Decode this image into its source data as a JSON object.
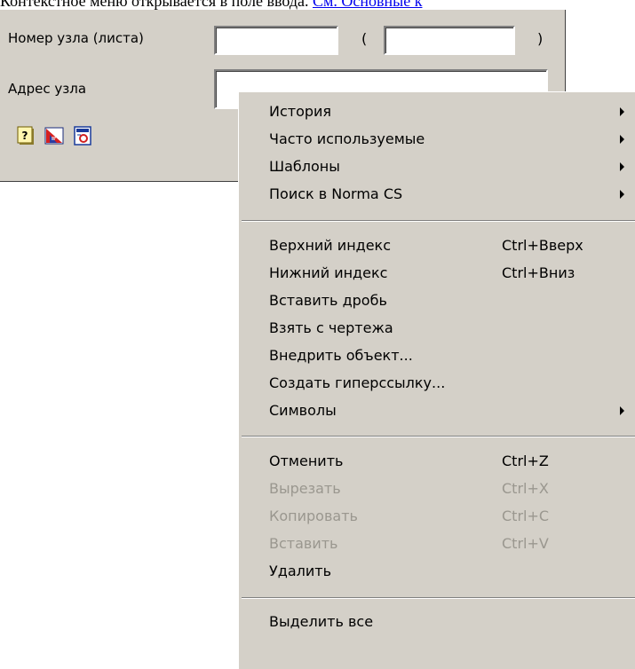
{
  "note": {
    "text": "Контекстное меню открывается в поле ввода.",
    "link": "См. Основные к"
  },
  "form": {
    "node_number_label": "Номер узла (листа)",
    "open_paren": "(",
    "close_paren": ")",
    "node_address_label": "Адрес узла"
  },
  "icons": [
    "help-icon",
    "drawing-icon",
    "gost-icon"
  ],
  "menu": {
    "history": "История",
    "frequent": "Часто используемые",
    "templates": "Шаблоны",
    "search_norma": "Поиск в Norma CS",
    "superscript": "Верхний индекс",
    "superscript_key": "Ctrl+Вверх",
    "subscript": "Нижний индекс",
    "subscript_key": "Ctrl+Вниз",
    "insert_fraction": "Вставить дробь",
    "take_from_drawing": "Взять с чертежа",
    "embed_object": "Внедрить объект...",
    "create_hyperlink": "Создать гиперссылку...",
    "symbols": "Символы",
    "undo": "Отменить",
    "undo_key": "Ctrl+Z",
    "cut": "Вырезать",
    "cut_key": "Ctrl+X",
    "copy": "Копировать",
    "copy_key": "Ctrl+C",
    "paste": "Вставить",
    "paste_key": "Ctrl+V",
    "delete": "Удалить",
    "select_all": "Выделить все"
  },
  "colors": {
    "dialog_bg": "#d4d0c8",
    "disabled_text": "#9a978f",
    "link": "#0000ee"
  }
}
